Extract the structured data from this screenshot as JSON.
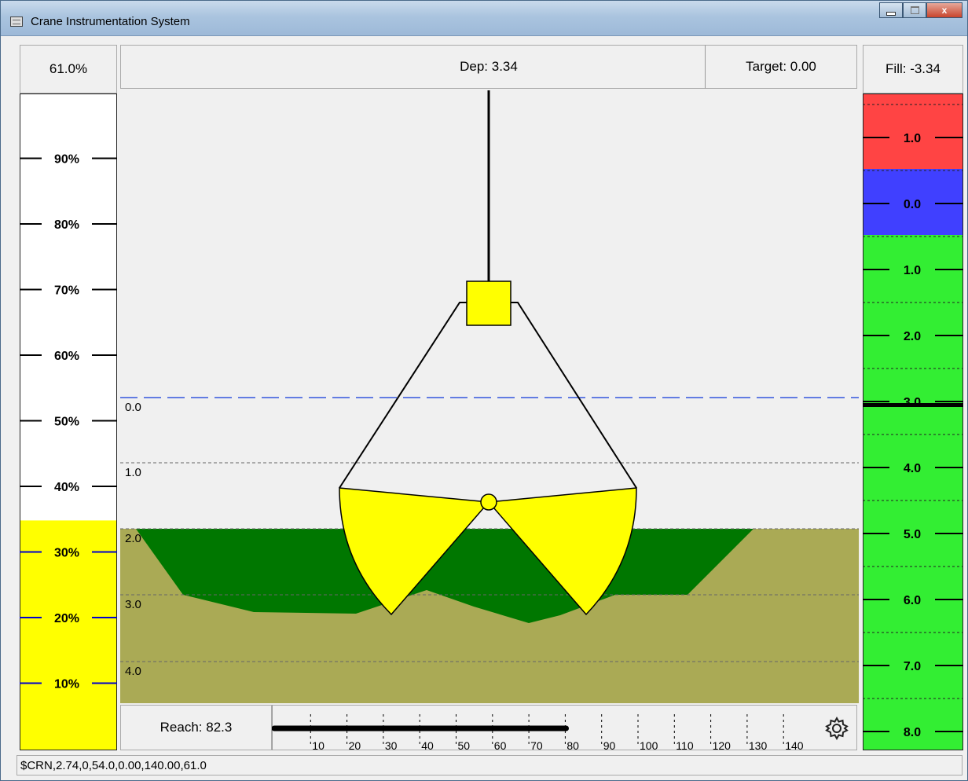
{
  "window": {
    "title": "Crane Instrumentation System",
    "controls": {
      "minimize": "",
      "maximize": "",
      "close": "x"
    }
  },
  "header": {
    "percent": "61.0%",
    "depth": "Dep: 3.34",
    "target": "Target: 0.00",
    "fill": "Fill: -3.34"
  },
  "left_gauge": {
    "labels": [
      "90%",
      "80%",
      "70%",
      "60%",
      "50%",
      "40%",
      "30%",
      "20%",
      "10%"
    ],
    "level_fraction": 0.35,
    "fill_color": "#ffff00"
  },
  "right_gauge": {
    "labels": [
      "1.0",
      "0.0",
      "1.0",
      "2.0",
      "3.0",
      "4.0",
      "5.0",
      "6.0",
      "7.0",
      "8.0"
    ],
    "colors": {
      "above": "#ff4444",
      "zero": "#4040ff",
      "below": "#33ee33"
    },
    "marker_value": 3.34
  },
  "depth_view": {
    "depth_labels": [
      "0.0",
      "1.0",
      "2.0",
      "3.0",
      "4.0"
    ],
    "colors": {
      "seabed": "#aaaa55",
      "dredged": "#007700",
      "bucket": "#ffff00",
      "water_line": "#3355dd"
    }
  },
  "reach": {
    "label": "Reach: 82.3",
    "value": 82.3,
    "max": 140,
    "ticks": [
      "10",
      "20",
      "30",
      "40",
      "50",
      "60",
      "70",
      "80",
      "90",
      "100",
      "110",
      "120",
      "130",
      "140"
    ]
  },
  "settings": {
    "icon": "gear-icon"
  },
  "status_bar": {
    "text": "$CRN,2.74,0,54.0,0.00,140.00,61.0"
  }
}
